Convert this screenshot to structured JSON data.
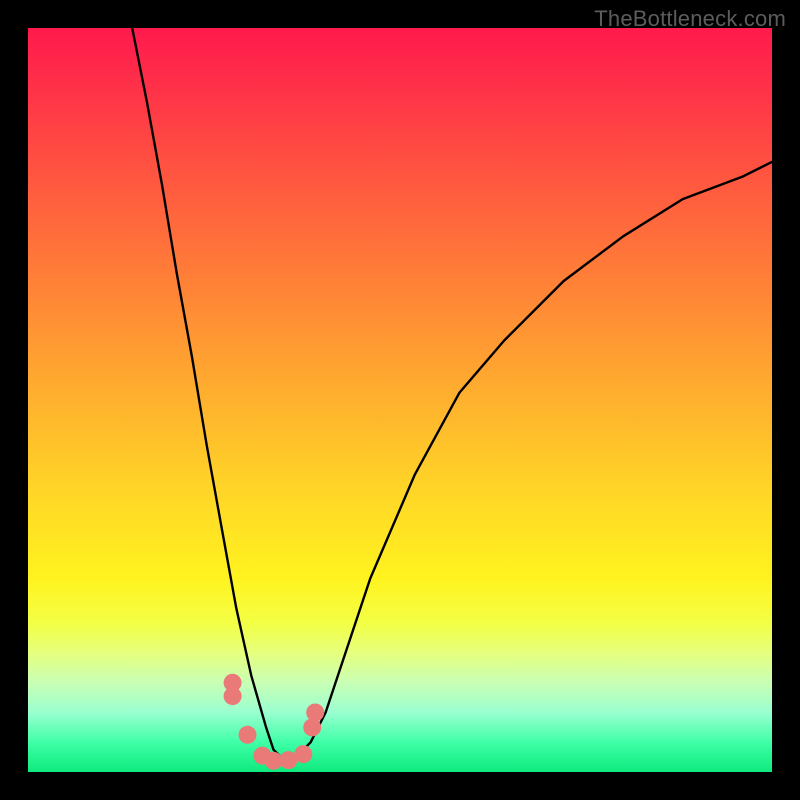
{
  "watermark": "TheBottleneck.com",
  "chart_data": {
    "type": "line",
    "title": "",
    "xlabel": "",
    "ylabel": "",
    "xlim": [
      0,
      100
    ],
    "ylim": [
      0,
      100
    ],
    "series": [
      {
        "name": "curve",
        "x": [
          14,
          16,
          18,
          20,
          22,
          24,
          26,
          28,
          30,
          32,
          33,
          34,
          36,
          38,
          40,
          42,
          46,
          52,
          58,
          64,
          72,
          80,
          88,
          96,
          100
        ],
        "values": [
          100,
          90,
          79,
          67,
          56,
          44,
          33,
          22,
          13,
          6,
          3,
          2,
          2,
          4,
          8,
          14,
          26,
          40,
          51,
          58,
          66,
          72,
          77,
          80,
          82
        ]
      }
    ],
    "markers": {
      "name": "highlight-dots",
      "color": "#e97a77",
      "x": [
        27.5,
        27.5,
        29.5,
        31.5,
        33.0,
        35.0,
        37.0,
        38.2,
        38.6
      ],
      "values": [
        12,
        10.2,
        5.0,
        2.2,
        1.5,
        1.6,
        2.4,
        6.0,
        8.0
      ]
    }
  }
}
